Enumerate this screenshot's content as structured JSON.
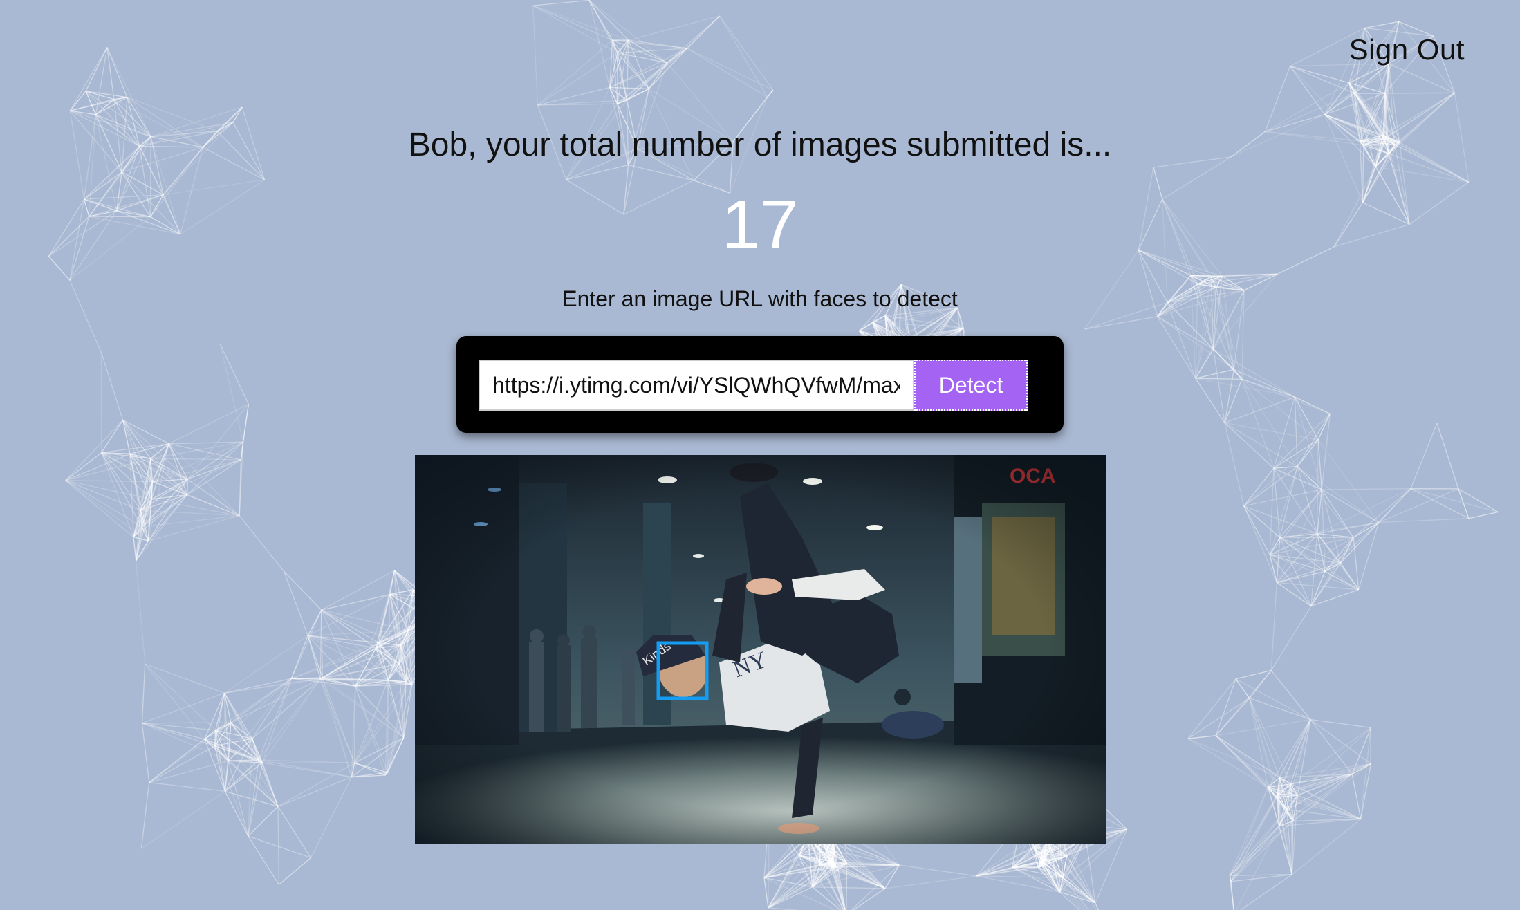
{
  "nav": {
    "sign_out": "Sign Out"
  },
  "rank": {
    "message": "Bob, your total number of images submitted is...",
    "count": "17"
  },
  "form": {
    "instruction": "Enter an image URL with faces to detect",
    "url_value": "https://i.ytimg.com/vi/YSlQWhQVfwM/max",
    "detect_label": "Detect"
  },
  "colors": {
    "background": "#aab9d3",
    "button": "#a463f2",
    "face_box": "#149df2",
    "panel": "#000000"
  }
}
